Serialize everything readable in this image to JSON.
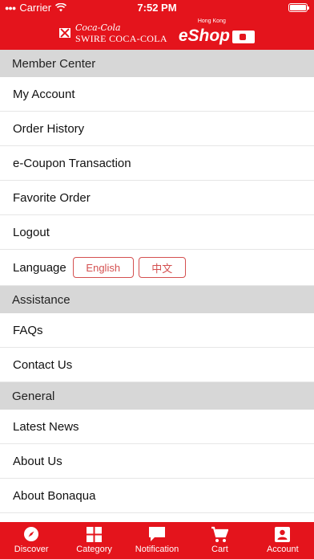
{
  "status_bar": {
    "carrier": "Carrier",
    "time": "7:52 PM"
  },
  "header": {
    "brand_script": "Coca-Cola",
    "brand_name": "SWIRE COCA-COLA",
    "eshop_sub": "Hong Kong",
    "eshop_main": "eShop",
    "color": "#e4141c"
  },
  "sections": {
    "member": {
      "title": "Member Center",
      "items": [
        "My Account",
        "Order History",
        "e-Coupon Transaction",
        "Favorite Order",
        "Logout"
      ],
      "language_label": "Language",
      "language_options": [
        "English",
        "中文"
      ]
    },
    "assistance": {
      "title": "Assistance",
      "items": [
        "FAQs",
        "Contact Us"
      ]
    },
    "general": {
      "title": "General",
      "items": [
        "Latest News",
        "About Us",
        "About Bonaqua"
      ]
    }
  },
  "tabbar": {
    "tabs": [
      {
        "label": "Discover",
        "icon": "compass-icon"
      },
      {
        "label": "Category",
        "icon": "grid-icon"
      },
      {
        "label": "Notification",
        "icon": "chat-icon"
      },
      {
        "label": "Cart",
        "icon": "cart-icon"
      },
      {
        "label": "Account",
        "icon": "account-icon"
      }
    ]
  }
}
